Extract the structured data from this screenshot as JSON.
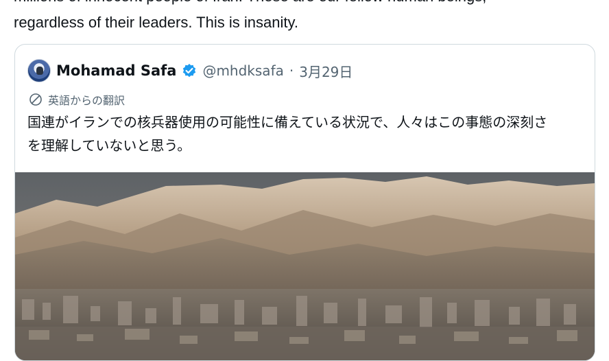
{
  "post": {
    "text_line_1": "millions of innocent people of Iran. These are our fellow human beings,",
    "text_line_2": "regardless of their leaders. This is insanity."
  },
  "quote": {
    "author_name": "Mohamad Safa",
    "handle": "@mhdksafa",
    "separator": "·",
    "date": "3月29日",
    "verified_icon": "verified-badge-icon",
    "translation_label": "英語からの翻訳",
    "text_line_1": "国連がイランでの核兵器使用の可能性に備えている状況で、人々はこの事態の深刻さ",
    "text_line_2": "を理解していないと思う。",
    "media_description_icon": "city-mountains-photo"
  },
  "colors": {
    "text_primary": "#0f1419",
    "text_secondary": "#536471",
    "border": "#cfd9de",
    "verified_blue": "#1d9bf0"
  }
}
